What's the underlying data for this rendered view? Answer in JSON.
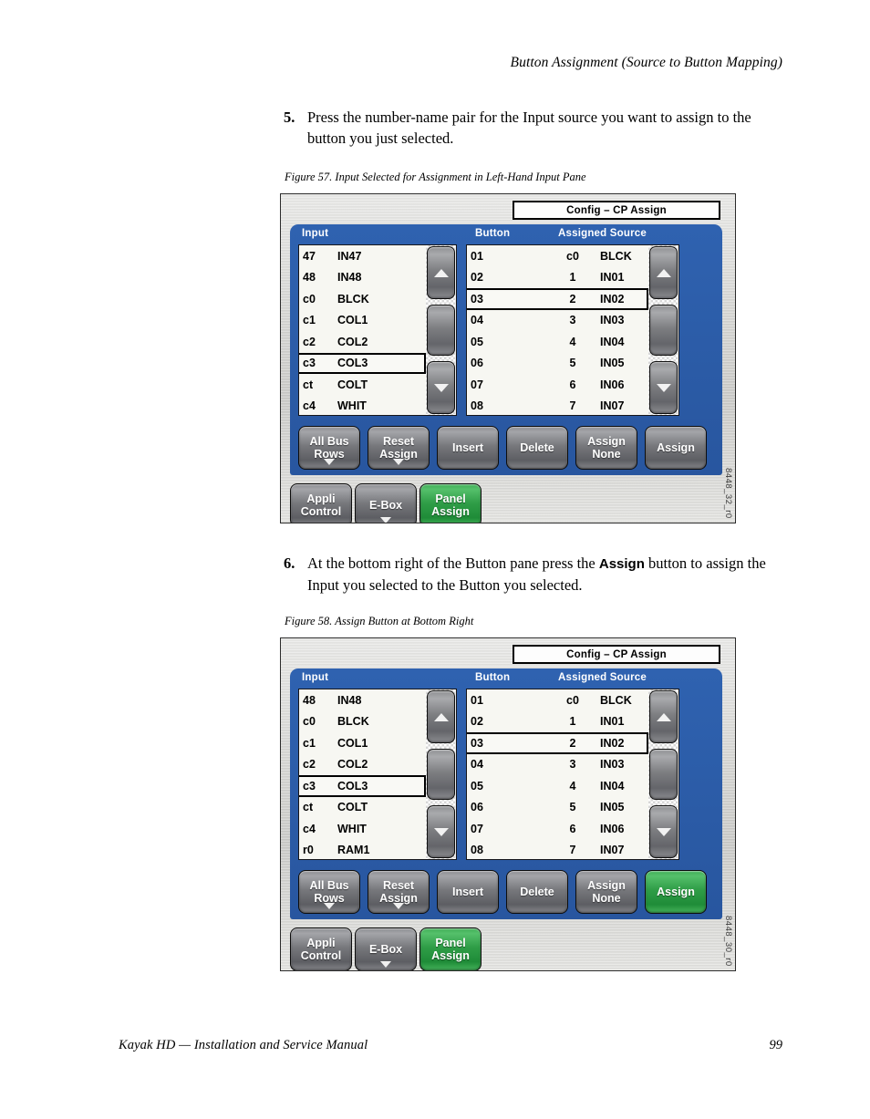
{
  "page": {
    "running_head": "Button Assignment (Source to Button Mapping)",
    "footer_title": "Kayak HD  —  Installation and Service Manual",
    "page_number": "99"
  },
  "steps": [
    {
      "number": "5.",
      "text_before": "Press the number-name pair for the Input source you want to assign to the button you just selected.",
      "bold": "",
      "text_after": ""
    },
    {
      "number": "6.",
      "text_before": "At the bottom right of the Button pane press the ",
      "bold": "Assign",
      "text_after": " button to assign the Input you selected to the Button you selected."
    }
  ],
  "figures": [
    {
      "caption": "Figure 57.  Input Selected for Assignment in Left-Hand Input Pane",
      "figure_id": "8448_32_r0",
      "title_box": "Config – CP Assign",
      "input_pane": {
        "header": "Input",
        "rows": [
          {
            "num": "47",
            "name": "IN47",
            "selected": false
          },
          {
            "num": "48",
            "name": "IN48",
            "selected": false
          },
          {
            "num": "c0",
            "name": "BLCK",
            "selected": false
          },
          {
            "num": "c1",
            "name": "COL1",
            "selected": false
          },
          {
            "num": "c2",
            "name": "COL2",
            "selected": false
          },
          {
            "num": "c3",
            "name": "COL3",
            "selected": true
          },
          {
            "num": "ct",
            "name": "COLT",
            "selected": false
          },
          {
            "num": "c4",
            "name": "WHIT",
            "selected": false
          }
        ]
      },
      "button_pane": {
        "header_button": "Button",
        "header_assigned": "Assigned Source",
        "rows": [
          {
            "button": "01",
            "src_num": "c0",
            "src_name": "BLCK",
            "selected": false
          },
          {
            "button": "02",
            "src_num": "1",
            "src_name": "IN01",
            "selected": false
          },
          {
            "button": "03",
            "src_num": "2",
            "src_name": "IN02",
            "selected": true
          },
          {
            "button": "04",
            "src_num": "3",
            "src_name": "IN03",
            "selected": false
          },
          {
            "button": "05",
            "src_num": "4",
            "src_name": "IN04",
            "selected": false
          },
          {
            "button": "06",
            "src_num": "5",
            "src_name": "IN05",
            "selected": false
          },
          {
            "button": "07",
            "src_num": "6",
            "src_name": "IN06",
            "selected": false
          },
          {
            "button": "08",
            "src_num": "7",
            "src_name": "IN07",
            "selected": false
          }
        ]
      },
      "soft_buttons": [
        {
          "line1": "All Bus",
          "line2": "Rows",
          "caret": true,
          "state": "normal"
        },
        {
          "line1": "Reset",
          "line2": "Assign",
          "caret": true,
          "state": "normal"
        },
        {
          "line1": "Insert",
          "line2": "",
          "caret": false,
          "state": "normal"
        },
        {
          "line1": "Delete",
          "line2": "",
          "caret": false,
          "state": "normal"
        },
        {
          "line1": "Assign",
          "line2": "None",
          "caret": false,
          "state": "normal"
        },
        {
          "line1": "Assign",
          "line2": "",
          "caret": false,
          "state": "normal"
        }
      ],
      "app_buttons": [
        {
          "line1": "Appli",
          "line2": "Control",
          "caret": false,
          "state": "normal"
        },
        {
          "line1": "E-Box",
          "line2": "",
          "caret": true,
          "state": "normal"
        },
        {
          "line1": "Panel",
          "line2": "Assign",
          "caret": false,
          "state": "green"
        }
      ]
    },
    {
      "caption": "Figure 58.  Assign Button at Bottom Right",
      "figure_id": "8448_30_r0",
      "title_box": "Config – CP Assign",
      "input_pane": {
        "header": "Input",
        "rows": [
          {
            "num": "48",
            "name": "IN48",
            "selected": false
          },
          {
            "num": "c0",
            "name": "BLCK",
            "selected": false
          },
          {
            "num": "c1",
            "name": "COL1",
            "selected": false
          },
          {
            "num": "c2",
            "name": "COL2",
            "selected": false
          },
          {
            "num": "c3",
            "name": "COL3",
            "selected": true
          },
          {
            "num": "ct",
            "name": "COLT",
            "selected": false
          },
          {
            "num": "c4",
            "name": "WHIT",
            "selected": false
          },
          {
            "num": "r0",
            "name": "RAM1",
            "selected": false
          }
        ]
      },
      "button_pane": {
        "header_button": "Button",
        "header_assigned": "Assigned Source",
        "rows": [
          {
            "button": "01",
            "src_num": "c0",
            "src_name": "BLCK",
            "selected": false
          },
          {
            "button": "02",
            "src_num": "1",
            "src_name": "IN01",
            "selected": false
          },
          {
            "button": "03",
            "src_num": "2",
            "src_name": "IN02",
            "selected": true
          },
          {
            "button": "04",
            "src_num": "3",
            "src_name": "IN03",
            "selected": false
          },
          {
            "button": "05",
            "src_num": "4",
            "src_name": "IN04",
            "selected": false
          },
          {
            "button": "06",
            "src_num": "5",
            "src_name": "IN05",
            "selected": false
          },
          {
            "button": "07",
            "src_num": "6",
            "src_name": "IN06",
            "selected": false
          },
          {
            "button": "08",
            "src_num": "7",
            "src_name": "IN07",
            "selected": false
          }
        ]
      },
      "soft_buttons": [
        {
          "line1": "All Bus",
          "line2": "Rows",
          "caret": true,
          "state": "normal"
        },
        {
          "line1": "Reset",
          "line2": "Assign",
          "caret": true,
          "state": "normal"
        },
        {
          "line1": "Insert",
          "line2": "",
          "caret": false,
          "state": "normal"
        },
        {
          "line1": "Delete",
          "line2": "",
          "caret": false,
          "state": "normal"
        },
        {
          "line1": "Assign",
          "line2": "None",
          "caret": false,
          "state": "normal"
        },
        {
          "line1": "Assign",
          "line2": "",
          "caret": false,
          "state": "green"
        }
      ],
      "app_buttons": [
        {
          "line1": "Appli",
          "line2": "Control",
          "caret": false,
          "state": "normal"
        },
        {
          "line1": "E-Box",
          "line2": "",
          "caret": true,
          "state": "normal"
        },
        {
          "line1": "Panel",
          "line2": "Assign",
          "caret": false,
          "state": "green"
        }
      ]
    }
  ],
  "icons": {
    "scroll_up": "triangle-up-icon",
    "scroll_thumb": "scroll-thumb",
    "scroll_down": "triangle-down-icon",
    "menu_caret": "caret-down-icon"
  },
  "colors": {
    "pane_blue": "#2a5caa",
    "button_green": "#2f9d47",
    "list_bg": "#f7f7f2",
    "panel_metal": "#d4d4d1"
  }
}
